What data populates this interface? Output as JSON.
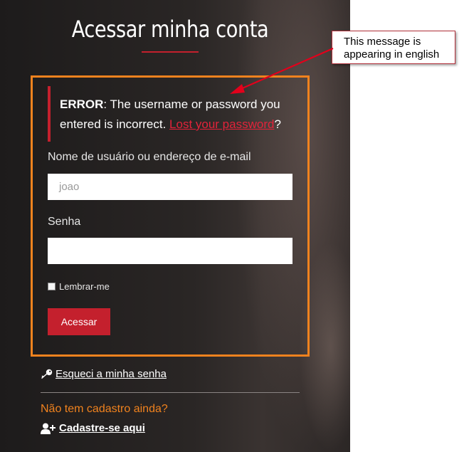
{
  "login": {
    "title": "Acessar minha conta",
    "error": {
      "prefix": "ERROR",
      "message": ": The username or password you entered is incorrect.",
      "link": "Lost your password",
      "suffix": "?"
    },
    "username_label": "Nome de usuário ou endereço de e-mail",
    "username_value": "joao",
    "password_label": "Senha",
    "password_value": "",
    "remember_label": "Lembrar-me",
    "remember_checked": false,
    "submit_label": "Acessar"
  },
  "footer": {
    "forgot_label": "Esqueci a minha senha",
    "no_account_text": "Não tem cadastro ainda?",
    "register_label": "Cadastre-se aqui"
  },
  "annotation": {
    "callout_text": "This message is appearing in english"
  },
  "colors": {
    "accent_red": "#c4202d",
    "highlight_orange": "#f0821e",
    "panel_dark": "#1d1b1b"
  },
  "icons": [
    "key-icon",
    "add-user-icon"
  ]
}
